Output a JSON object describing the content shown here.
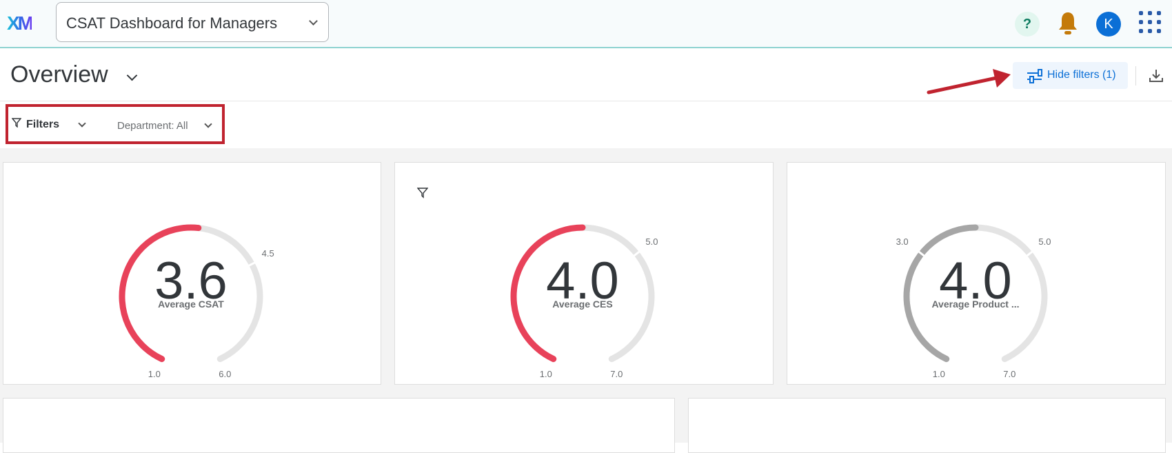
{
  "app": {
    "logo": "XM",
    "dashboard": "CSAT Dashboard for Managers",
    "avatar_initial": "K",
    "help": "?"
  },
  "page": {
    "title": "Overview",
    "hide_filters": "Hide filters (1)"
  },
  "filters": {
    "label": "Filters",
    "department_label": "Department:",
    "department_value": "All"
  },
  "colors": {
    "accent": "#0b6fd6",
    "gauge_red": "#e8425a",
    "gauge_gray": "#a6a6a6",
    "track": "#e4e4e4",
    "annotation": "#c0232f"
  },
  "gauges": [
    {
      "value": "3.6",
      "num": 3.6,
      "label": "Average CSAT",
      "min": "1.0",
      "max": "6.0",
      "minv": 1,
      "maxv": 6,
      "marker": "4.5",
      "markerv": 4.5,
      "color": "#e8425a",
      "filtered": false
    },
    {
      "value": "4.0",
      "num": 4.0,
      "label": "Average CES",
      "min": "1.0",
      "max": "7.0",
      "minv": 1,
      "maxv": 7,
      "marker": "5.0",
      "markerv": 5,
      "color": "#e8425a",
      "filtered": true
    },
    {
      "value": "4.0",
      "num": 4.0,
      "label": "Average Product ...",
      "min": "1.0",
      "max": "7.0",
      "minv": 1,
      "maxv": 7,
      "marker": "5.0",
      "markerv": 5,
      "marker2": "3.0",
      "marker2v": 3,
      "color": "#a6a6a6",
      "filtered": false
    }
  ]
}
